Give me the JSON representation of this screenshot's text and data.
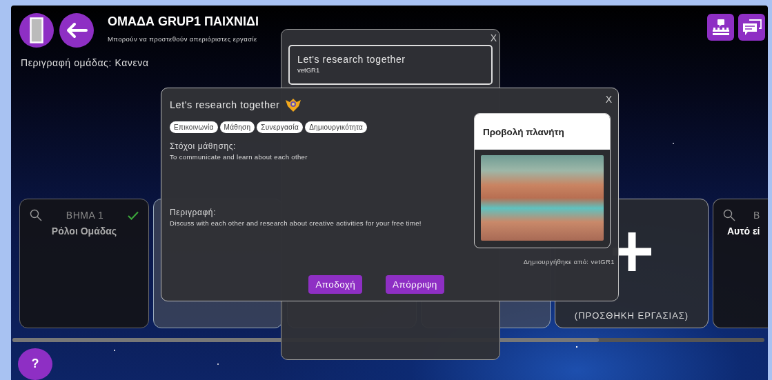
{
  "header": {
    "title": "ΟΜΑΔΑ GRUP1 ΠΑΙΧΝΙΔΙ",
    "subtitle": "Μπορούν να προστεθούν απεριόριστες εργασίε",
    "description": "Περιγραφή ομάδας: Κανενα"
  },
  "steps": [
    {
      "kind": "step",
      "step": "ΒΗΜΑ 1",
      "name": "Ρόλοι Ομάδας",
      "completed": true
    },
    {
      "kind": "blank"
    },
    {
      "kind": "blank"
    },
    {
      "kind": "blank"
    },
    {
      "kind": "add",
      "label": "(ΠΡΟΣΘΗΚΗ ΕΡΓΑΣΙΑΣ)"
    },
    {
      "kind": "step",
      "step": "Β",
      "name": "Αυτό εί",
      "completed": false
    }
  ],
  "help": "?",
  "back_dialog": {
    "close": "X",
    "card_title": "Let's research together",
    "card_author": "vetGR1"
  },
  "dialog": {
    "title": "Let's research together",
    "close": "X",
    "tags": [
      "Επικοινωνία",
      "Μάθηση",
      "Συνεργασία",
      "Δημιουργικότητα"
    ],
    "goals_label": "Στόχοι μάθησης:",
    "goals": "To communicate and learn about each other",
    "description_label": "Περιγραφή:",
    "description": "Discuss with each other and research about creative activities for your free time!",
    "preview_title": "Προβολή πλανήτη",
    "created_by": "Δημιουργήθηκε από: vetGR1",
    "buttons": [
      "Αποδοχή",
      "Απόρριψη"
    ]
  }
}
